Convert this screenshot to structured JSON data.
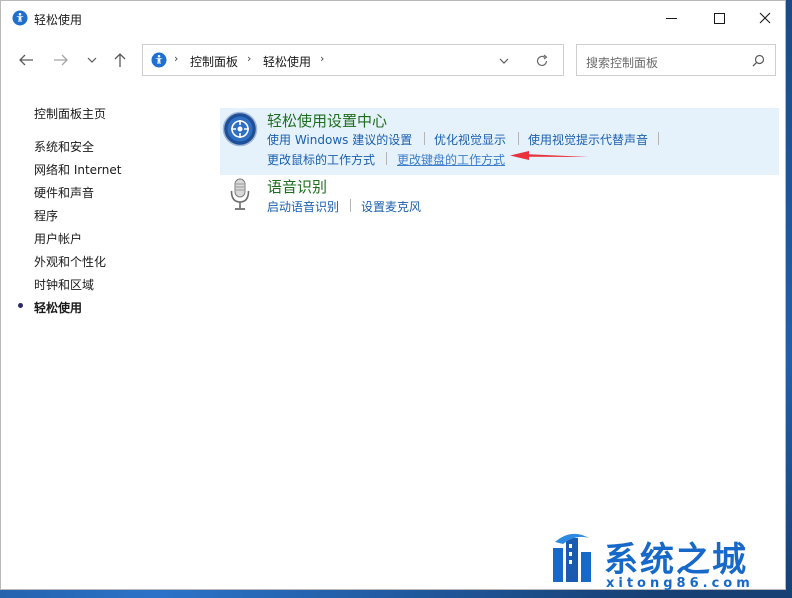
{
  "window": {
    "title": "轻松使用"
  },
  "address": {
    "crumbs": [
      "控制面板",
      "轻松使用"
    ]
  },
  "search": {
    "placeholder": "搜索控制面板"
  },
  "sidebar": {
    "home": "控制面板主页",
    "items": [
      {
        "label": "系统和安全"
      },
      {
        "label": "网络和 Internet"
      },
      {
        "label": "硬件和声音"
      },
      {
        "label": "程序"
      },
      {
        "label": "用户帐户"
      },
      {
        "label": "外观和个性化"
      },
      {
        "label": "时钟和区域"
      },
      {
        "label": "轻松使用",
        "current": true
      }
    ]
  },
  "main": {
    "categories": [
      {
        "title": "轻松使用设置中心",
        "icon": "ease-of-access-center-icon",
        "links_row1": [
          "使用 Windows 建议的设置",
          "优化视觉显示",
          "使用视觉提示代替声音"
        ],
        "links_row2": [
          "更改鼠标的工作方式",
          "更改键盘的工作方式"
        ]
      },
      {
        "title": "语音识别",
        "icon": "microphone-icon",
        "links_row1": [
          "启动语音识别",
          "设置麦克风"
        ]
      }
    ],
    "annotation_arrow_color": "#e8323c"
  },
  "watermark": {
    "text": "系统之城",
    "sub": "xitong86.com"
  }
}
